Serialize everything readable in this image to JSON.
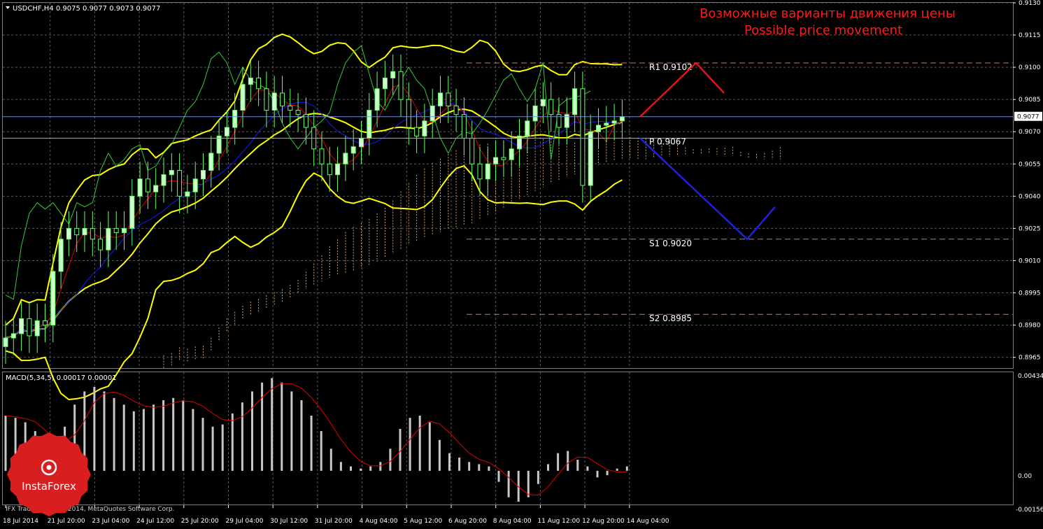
{
  "header": {
    "symbol_line": "USDCHF,H4  0.9075 0.9077 0.9073 0.9077",
    "annotation_ru": "Возможные варианты движения цены",
    "annotation_en": "Possible price movement"
  },
  "macd": {
    "label": "MACD(5,34,5) 0.00017 0.00001",
    "axis_labels": [
      "0.00434",
      "0.00",
      "-0.00156"
    ]
  },
  "footer": {
    "copyright": "IFX Trader, © 2001-2014, MetaQuotes Software Corp.",
    "logo_text": "InstaForex"
  },
  "colors": {
    "background": "#000000",
    "grid": "#5a5a5a",
    "bull_candle": "#ccffcc",
    "bear_candle": "#66ff66",
    "bollinger": "#ffff00",
    "tenkan": "#e00000",
    "kijun": "#1a1aff",
    "chikou": "#33cc33",
    "cloud": "#d2a36a",
    "current_price_line": "#6d8fd8",
    "pivot_line": "#d4b000",
    "level_line": "#d1775a",
    "forecast_up": "#e01515",
    "forecast_down": "#2020e0",
    "annotation_text": "#ff1a1a",
    "macd_hist": "#c8c8c8",
    "macd_signal": "#e00000",
    "logo": "#d81e1e"
  },
  "chart_data": {
    "type": "candlestick",
    "symbol": "USDCHF",
    "timeframe": "H4",
    "ylim": [
      0.896,
      0.913
    ],
    "y_ticks": [
      "0.9130",
      "0.9115",
      "0.9100",
      "0.9085",
      "0.9070",
      "0.9055",
      "0.9040",
      "0.9025",
      "0.9010",
      "0.8995",
      "0.8980",
      "0.8965"
    ],
    "x_tick_labels": [
      "18 Jul 2014",
      "21 Jul 20:00",
      "23 Jul 04:00",
      "24 Jul 12:00",
      "25 Jul 20:00",
      "29 Jul 04:00",
      "30 Jul 12:00",
      "31 Jul 20:00",
      "4 Aug 04:00",
      "5 Aug 12:00",
      "6 Aug 20:00",
      "8 Aug 04:00",
      "11 Aug 12:00",
      "12 Aug 20:00",
      "14 Aug 04:00"
    ],
    "current_price": "0.9077",
    "close_path": [
      0.8974,
      0.8976,
      0.8983,
      0.8975,
      0.8982,
      0.898,
      0.9005,
      0.902,
      0.9025,
      0.9022,
      0.9025,
      0.902,
      0.9015,
      0.9025,
      0.9023,
      0.9025,
      0.904,
      0.9048,
      0.9042,
      0.9045,
      0.905,
      0.9052,
      0.904,
      0.9042,
      0.9048,
      0.9052,
      0.906,
      0.9068,
      0.9072,
      0.908,
      0.9092,
      0.9095,
      0.909,
      0.908,
      0.9088,
      0.9082,
      0.908,
      0.9078,
      0.9072,
      0.9062,
      0.9055,
      0.905,
      0.9055,
      0.906,
      0.9063,
      0.9067,
      0.908,
      0.909,
      0.9095,
      0.9098,
      0.9085,
      0.9072,
      0.9068,
      0.9075,
      0.9082,
      0.9088,
      0.9082,
      0.9078,
      0.9067,
      0.9055,
      0.9048,
      0.9055,
      0.9058,
      0.9057,
      0.9062,
      0.9068,
      0.9075,
      0.9082,
      0.9085,
      0.9078,
      0.9072,
      0.9078,
      0.909,
      0.9045,
      0.907,
      0.9073,
      0.9074,
      0.9075,
      0.9077
    ],
    "levels": [
      {
        "name": "R1",
        "value": "0.9102",
        "label": "R1  0.9102"
      },
      {
        "name": "P",
        "value": "0.9067",
        "label": "P   0.9067"
      },
      {
        "name": "S1",
        "value": "0.9020",
        "label": "S1  0.9020"
      },
      {
        "name": "S2",
        "value": "0.8985",
        "label": "S2  0.8985"
      }
    ],
    "forecast_up": [
      0.9077,
      0.9102,
      0.9088
    ],
    "forecast_down": [
      0.9067,
      0.902,
      0.9035
    ],
    "macd_ylim": [
      -0.00156,
      0.00434
    ],
    "macd_hist_path": [
      0.0025,
      0.0024,
      0.0022,
      0.0018,
      0.001,
      0.0005,
      0.002,
      0.003,
      0.0036,
      0.0038,
      0.0036,
      0.0033,
      0.003,
      0.0027,
      0.0028,
      0.003,
      0.0032,
      0.0033,
      0.0032,
      0.0028,
      0.0024,
      0.002,
      0.0021,
      0.0026,
      0.0031,
      0.0036,
      0.004,
      0.0042,
      0.004,
      0.0036,
      0.0032,
      0.0025,
      0.0018,
      0.001,
      0.0004,
      0.0002,
      0.0001,
      0.0002,
      0.0004,
      0.001,
      0.0019,
      0.0024,
      0.0025,
      0.0022,
      0.0014,
      0.0008,
      0.0006,
      0.0004,
      0.0003,
      0.0002,
      -0.0005,
      -0.0012,
      -0.0014,
      -0.0012,
      -0.0006,
      0.0003,
      0.0008,
      0.0009,
      0.0005,
      0.0002,
      -0.0003,
      -0.0002,
      0.0001,
      0.0002
    ]
  }
}
